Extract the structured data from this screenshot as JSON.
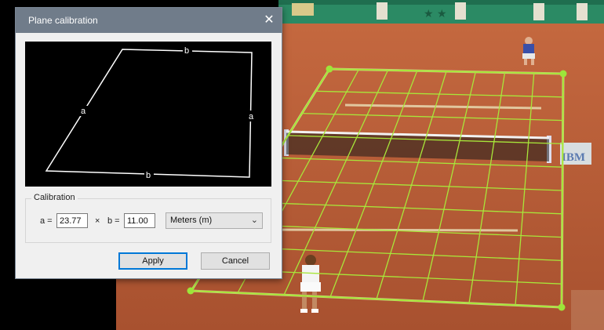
{
  "dialog": {
    "title": "Plane calibration",
    "close_glyph": "✕",
    "preview_labels": {
      "a_left": "a",
      "a_right": "a",
      "b_top": "b",
      "b_bottom": "b"
    },
    "calibration": {
      "legend": "Calibration",
      "a_label": "a =",
      "a_value": "23.77",
      "times": "×",
      "b_label": "b =",
      "b_value": "11.00",
      "unit_selected": "Meters (m)"
    },
    "buttons": {
      "apply": "Apply",
      "cancel": "Cancel"
    }
  },
  "scene": {
    "banner_text": "IBM",
    "grid_color": "#a8e63a",
    "court_color": "#b65a36",
    "wall_color": "#2b8a64"
  },
  "icons": {
    "close": "close-icon",
    "dropdown": "chevron-down-icon"
  }
}
